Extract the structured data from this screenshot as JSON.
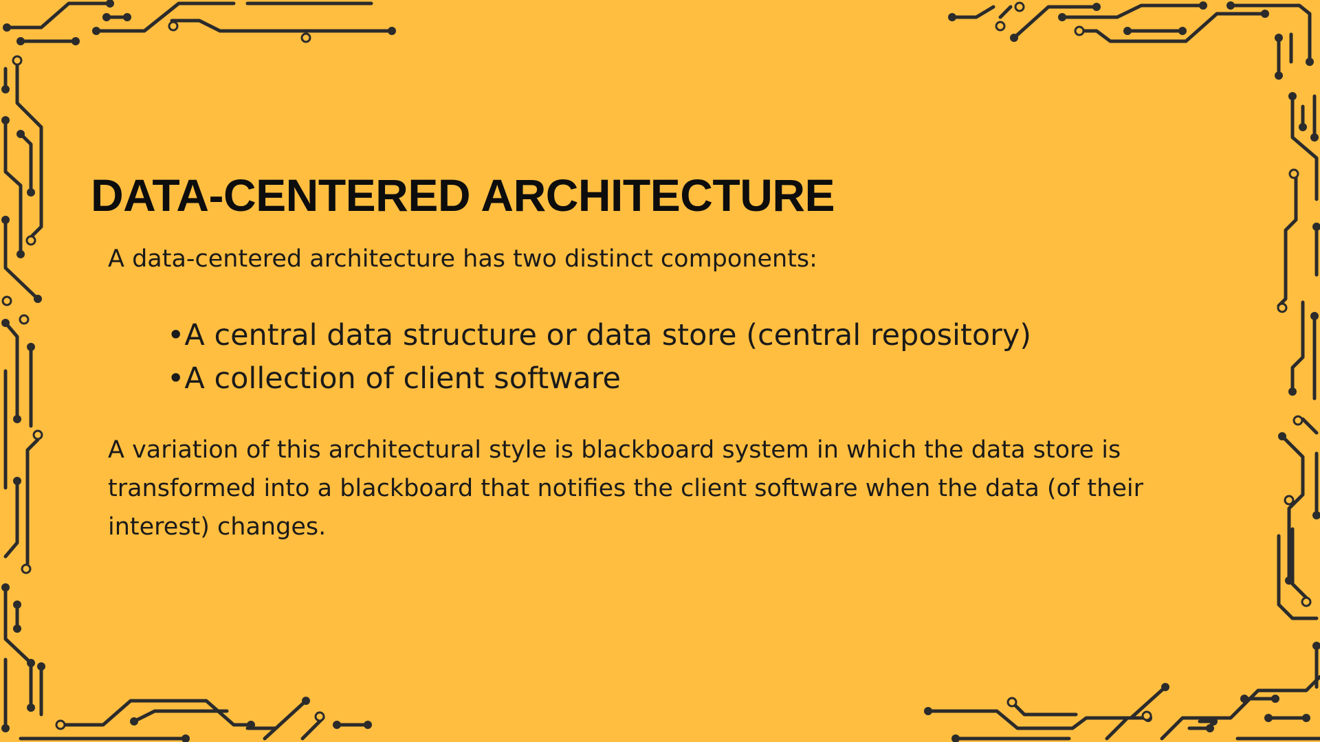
{
  "colors": {
    "background": "#FFBE40",
    "circuit": "#2b2b2b",
    "text": "#111111"
  },
  "slide": {
    "title": "DATA-CENTERED ARCHITECTURE",
    "intro": "A data-centered architecture has two distinct components:",
    "bullets": [
      "•A central data structure or data store (central repository)",
      "•A collection of client software"
    ],
    "variation": "A variation of this architectural style is blackboard system in which the data store is transformed into a blackboard that notifies the client software when the data (of their interest) changes."
  }
}
